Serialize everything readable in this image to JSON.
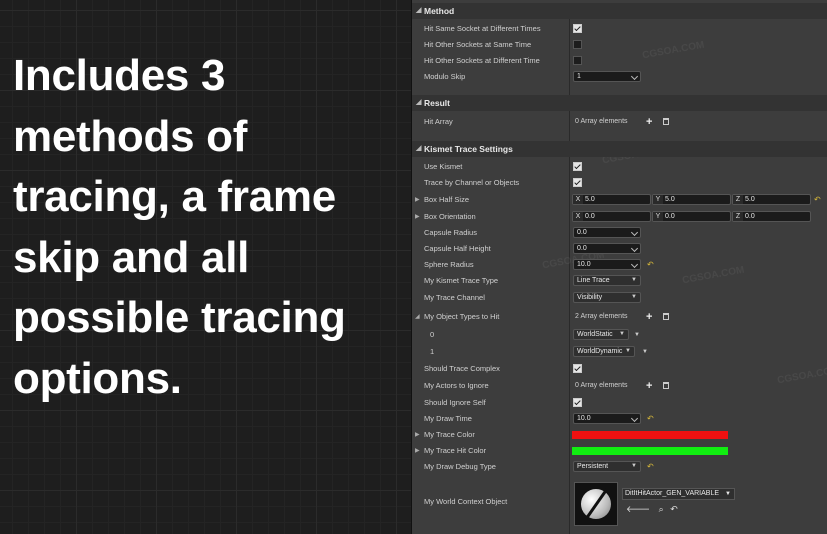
{
  "promo_text": "Includes 3 methods of tracing, a frame skip and all possible tracing options.",
  "categories": {
    "method": "Method",
    "result": "Result",
    "kismet": "Kismet Trace Settings"
  },
  "method": {
    "hit_same_socket": {
      "label": "Hit Same Socket at Different Times",
      "checked": true
    },
    "hit_other_same_time": {
      "label": "Hit Other Sockets at Same Time",
      "checked": false
    },
    "hit_other_diff_time": {
      "label": "Hit Other Sockets at Different Time",
      "checked": false
    },
    "modulo_skip": {
      "label": "Modulo Skip",
      "value": "1"
    }
  },
  "result": {
    "hit_array": {
      "label": "Hit Array",
      "value": "0 Array elements"
    }
  },
  "kismet": {
    "use_kismet": {
      "label": "Use Kismet",
      "checked": true
    },
    "trace_by_channel": {
      "label": "Trace by Channel or Objects",
      "checked": true
    },
    "box_half_size": {
      "label": "Box Half Size",
      "x": "5.0",
      "y": "5.0",
      "z": "5.0"
    },
    "box_orientation": {
      "label": "Box Orientation",
      "x": "0.0",
      "y": "0.0",
      "z": "0.0"
    },
    "capsule_radius": {
      "label": "Capsule Radius",
      "value": "0.0"
    },
    "capsule_half_height": {
      "label": "Capsule Half Height",
      "value": "0.0"
    },
    "sphere_radius": {
      "label": "Sphere Radius",
      "value": "10.0"
    },
    "trace_type": {
      "label": "My Kismet Trace Type",
      "value": "Line Trace"
    },
    "trace_channel": {
      "label": "My Trace Channel",
      "value": "Visibility"
    },
    "object_types": {
      "label": "My Object Types to Hit",
      "value": "2 Array elements",
      "items": [
        {
          "index": "0",
          "value": "WorldStatic"
        },
        {
          "index": "1",
          "value": "WorldDynamic"
        }
      ]
    },
    "trace_complex": {
      "label": "Should Trace Complex",
      "checked": true
    },
    "actors_ignore": {
      "label": "My Actors to Ignore",
      "value": "0 Array elements"
    },
    "ignore_self": {
      "label": "Should Ignore Self",
      "checked": true
    },
    "draw_time": {
      "label": "My Draw Time",
      "value": "10.0"
    },
    "trace_color": {
      "label": "My Trace Color",
      "color": "#ee1111"
    },
    "trace_hit_color": {
      "label": "My Trace Hit Color",
      "color": "#11ee11"
    },
    "draw_debug_type": {
      "label": "My Draw Debug Type",
      "value": "Persistent"
    },
    "world_context": {
      "label": "My World Context Object",
      "value": "DitItHitActor_GEN_VARIABLE"
    }
  },
  "axis_labels": {
    "x": "X",
    "y": "Y",
    "z": "Z"
  },
  "icons": {
    "reset": "reset-arrow-icon",
    "add": "plus-icon",
    "delete": "trash-icon",
    "browse": "magnifier-icon",
    "use": "arrow-left-icon"
  },
  "watermark": "CGSOA.COM"
}
